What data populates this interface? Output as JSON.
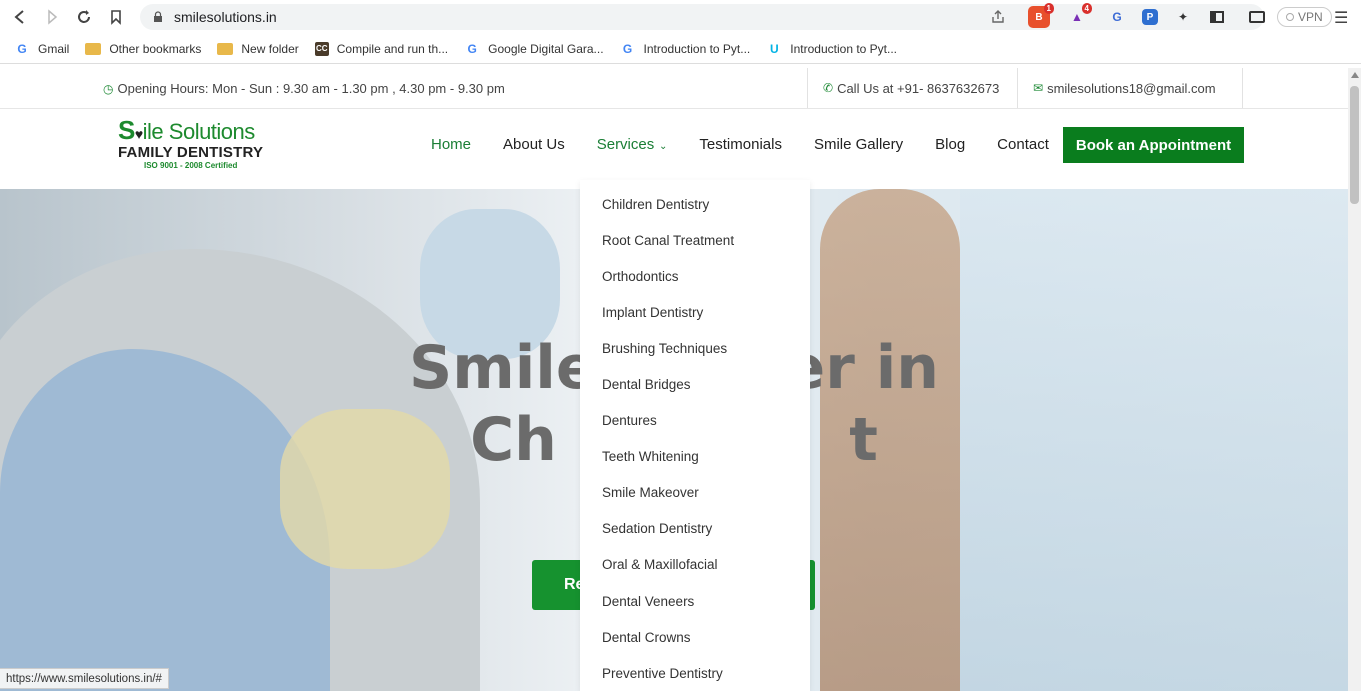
{
  "browser": {
    "url": "smilesolutions.in",
    "vpn_label": "VPN",
    "ext_badges": {
      "brave": "1",
      "rewards": "4"
    },
    "bookmarks": [
      {
        "label": "Gmail",
        "icon": "google-icon"
      },
      {
        "label": "Other bookmarks",
        "icon": "folder-icon"
      },
      {
        "label": "New folder",
        "icon": "folder-icon"
      },
      {
        "label": "Compile and run th...",
        "icon": "cc-icon"
      },
      {
        "label": "Google Digital Gara...",
        "icon": "google-icon"
      },
      {
        "label": "Introduction to Pyt...",
        "icon": "google-icon"
      },
      {
        "label": "Introduction to Pyt...",
        "icon": "udacity-icon"
      }
    ],
    "status_url": "https://www.smilesolutions.in/#"
  },
  "topbar": {
    "hours": "Opening Hours: Mon - Sun : 9.30 am - 1.30 pm , 4.30 pm - 9.30 pm",
    "phone": "Call Us at +91- 8637632673",
    "email": "smilesolutions18@gmail.com"
  },
  "logo": {
    "line1_s": "S",
    "line1_rest": "ile Solutions",
    "line2": "FAMILY DENTISTRY",
    "line3": "ISO 9001 - 2008 Certified"
  },
  "nav": {
    "home": "Home",
    "about": "About Us",
    "services": "Services",
    "testimonials": "Testimonials",
    "gallery": "Smile Gallery",
    "blog": "Blog",
    "contact": "Contact",
    "book": "Book an Appointment"
  },
  "hero": {
    "title_line1": "Smile         er in",
    "title_line2": "Ch              t",
    "button_partial": "Re"
  },
  "services_menu": [
    "Children Dentistry",
    "Root Canal Treatment",
    "Orthodontics",
    "Implant Dentistry",
    "Brushing Techniques",
    "Dental Bridges",
    "Dentures",
    "Teeth Whitening",
    "Smile Makeover",
    "Sedation Dentistry",
    "Oral & Maxillofacial",
    "Dental Veneers",
    "Dental Crowns",
    "Preventive Dentistry"
  ],
  "colors": {
    "brand_green": "#1a7e35",
    "button_green": "#0a7d1e"
  }
}
